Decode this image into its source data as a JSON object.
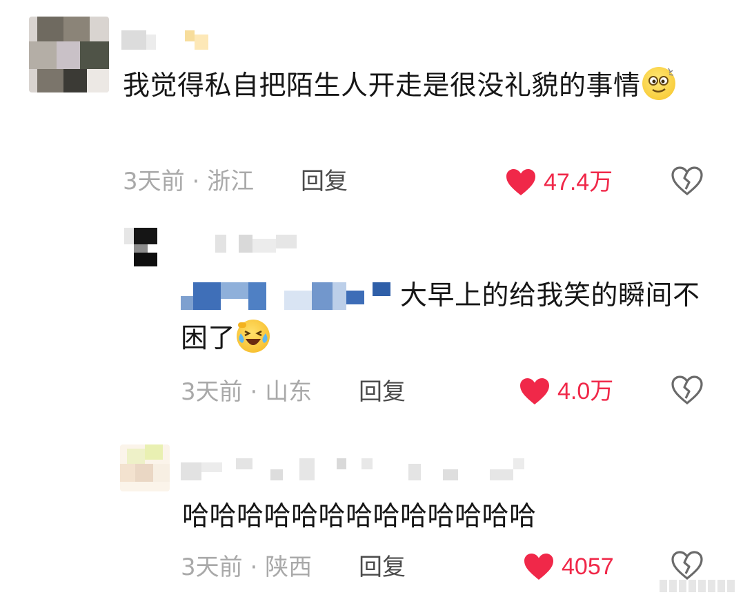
{
  "comments": [
    {
      "text": "我觉得私自把陌生人开走是很没礼貌的事情",
      "time": "3天前",
      "location": "浙江",
      "reply_label": "回复",
      "likes": "47.4万"
    },
    {
      "text": "大早上的给我笑的瞬间不困了",
      "time": "3天前",
      "location": "山东",
      "reply_label": "回复",
      "likes": "4.0万"
    },
    {
      "text": "哈哈哈哈哈哈哈哈哈哈哈哈哈",
      "time": "3天前",
      "location": "陕西",
      "reply_label": "回复",
      "likes": "4057"
    }
  ],
  "separator": " · ",
  "icons": {
    "like": "heart-icon",
    "dislike": "broken-heart-icon",
    "emoji_1": "dizzy-face-emoji",
    "emoji_2": "laughing-tears-emoji"
  },
  "colors": {
    "like_red": "#f02849",
    "meta_gray": "#a9a9a9"
  }
}
